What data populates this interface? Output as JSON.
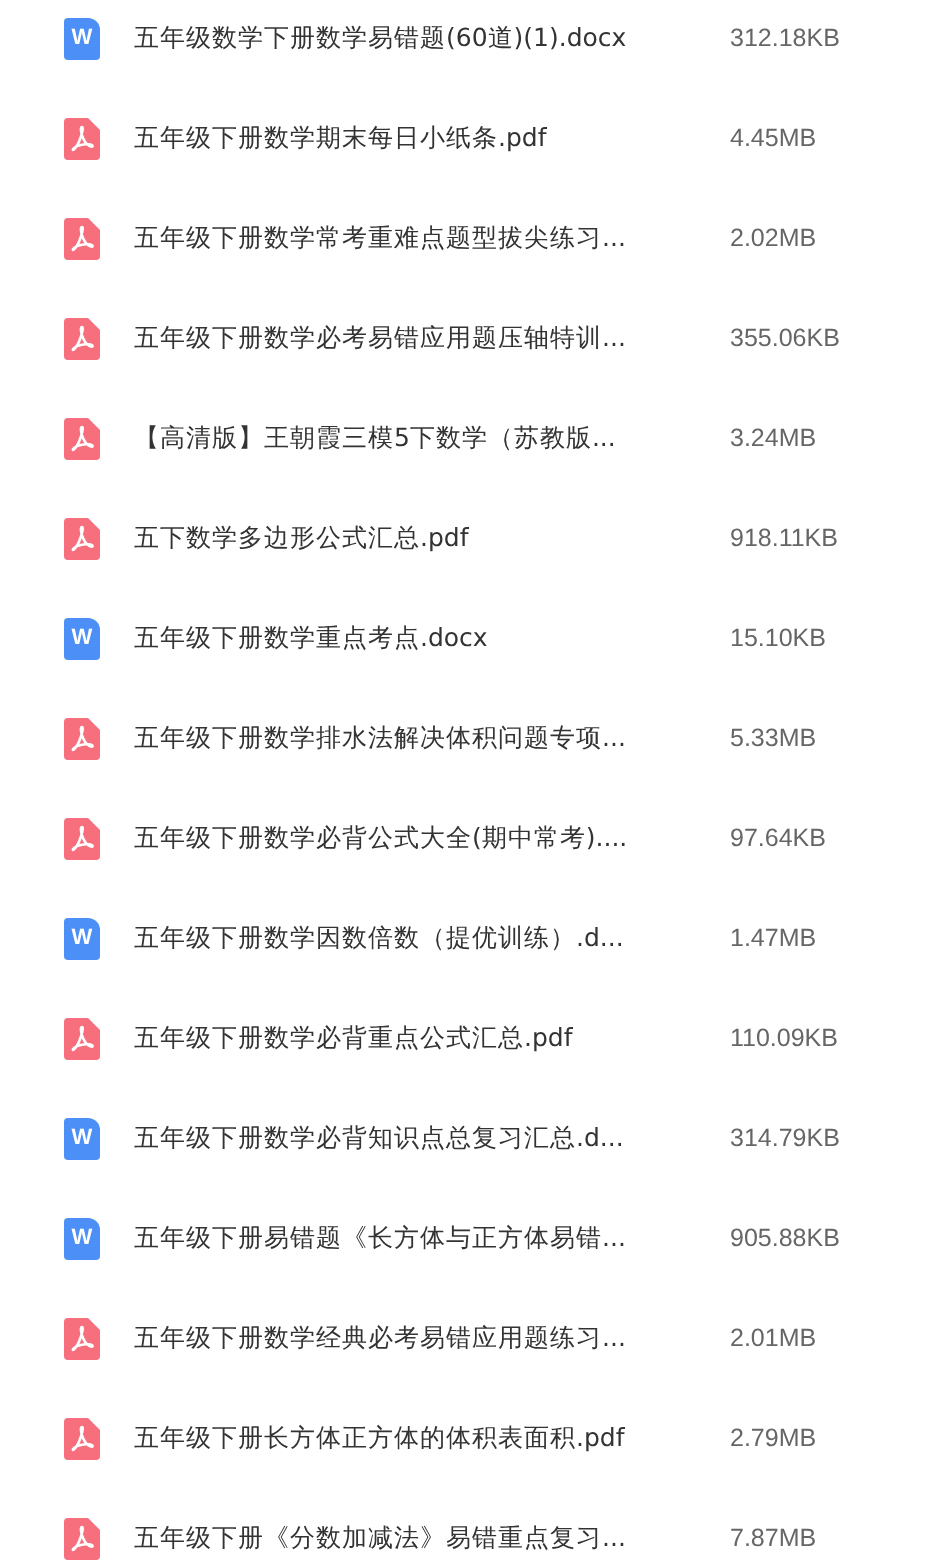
{
  "files": [
    {
      "kind": "word",
      "badge": "W",
      "name": "五年级数学下册数学易错题(60道)(1).docx",
      "size": "312.18KB"
    },
    {
      "kind": "pdf",
      "name": "五年级下册数学期末每日小纸条.pdf",
      "size": "4.45MB"
    },
    {
      "kind": "pdf",
      "name": "五年级下册数学常考重难点题型拔尖练习...",
      "size": "2.02MB"
    },
    {
      "kind": "pdf",
      "name": "五年级下册数学必考易错应用题压轴特训...",
      "size": "355.06KB"
    },
    {
      "kind": "pdf",
      "name": "【高清版】王朝霞三模5下数学（苏教版...",
      "size": "3.24MB"
    },
    {
      "kind": "pdf",
      "name": "五下数学多边形公式汇总.pdf",
      "size": "918.11KB"
    },
    {
      "kind": "word",
      "badge": "W",
      "name": "五年级下册数学重点考点.docx",
      "size": "15.10KB"
    },
    {
      "kind": "pdf",
      "name": "五年级下册数学排水法解决体积问题专项...",
      "size": "5.33MB"
    },
    {
      "kind": "pdf",
      "name": "五年级下册数学必背公式大全(期中常考)....",
      "size": "97.64KB"
    },
    {
      "kind": "word",
      "badge": "W",
      "name": "五年级下册数学因数倍数（提优训练）.d...",
      "size": "1.47MB"
    },
    {
      "kind": "pdf",
      "name": "五年级下册数学必背重点公式汇总.pdf",
      "size": "110.09KB"
    },
    {
      "kind": "word",
      "badge": "W",
      "name": "五年级下册数学必背知识点总复习汇总.d...",
      "size": "314.79KB"
    },
    {
      "kind": "word",
      "badge": "W",
      "name": "五年级下册易错题《长方体与正方体易错...",
      "size": "905.88KB"
    },
    {
      "kind": "pdf",
      "name": "五年级下册数学经典必考易错应用题练习...",
      "size": "2.01MB"
    },
    {
      "kind": "pdf",
      "name": "五年级下册长方体正方体的体积表面积.pdf",
      "size": "2.79MB"
    },
    {
      "kind": "pdf",
      "name": "五年级下册《分数加减法》易错重点复习...",
      "size": "7.87MB"
    }
  ]
}
